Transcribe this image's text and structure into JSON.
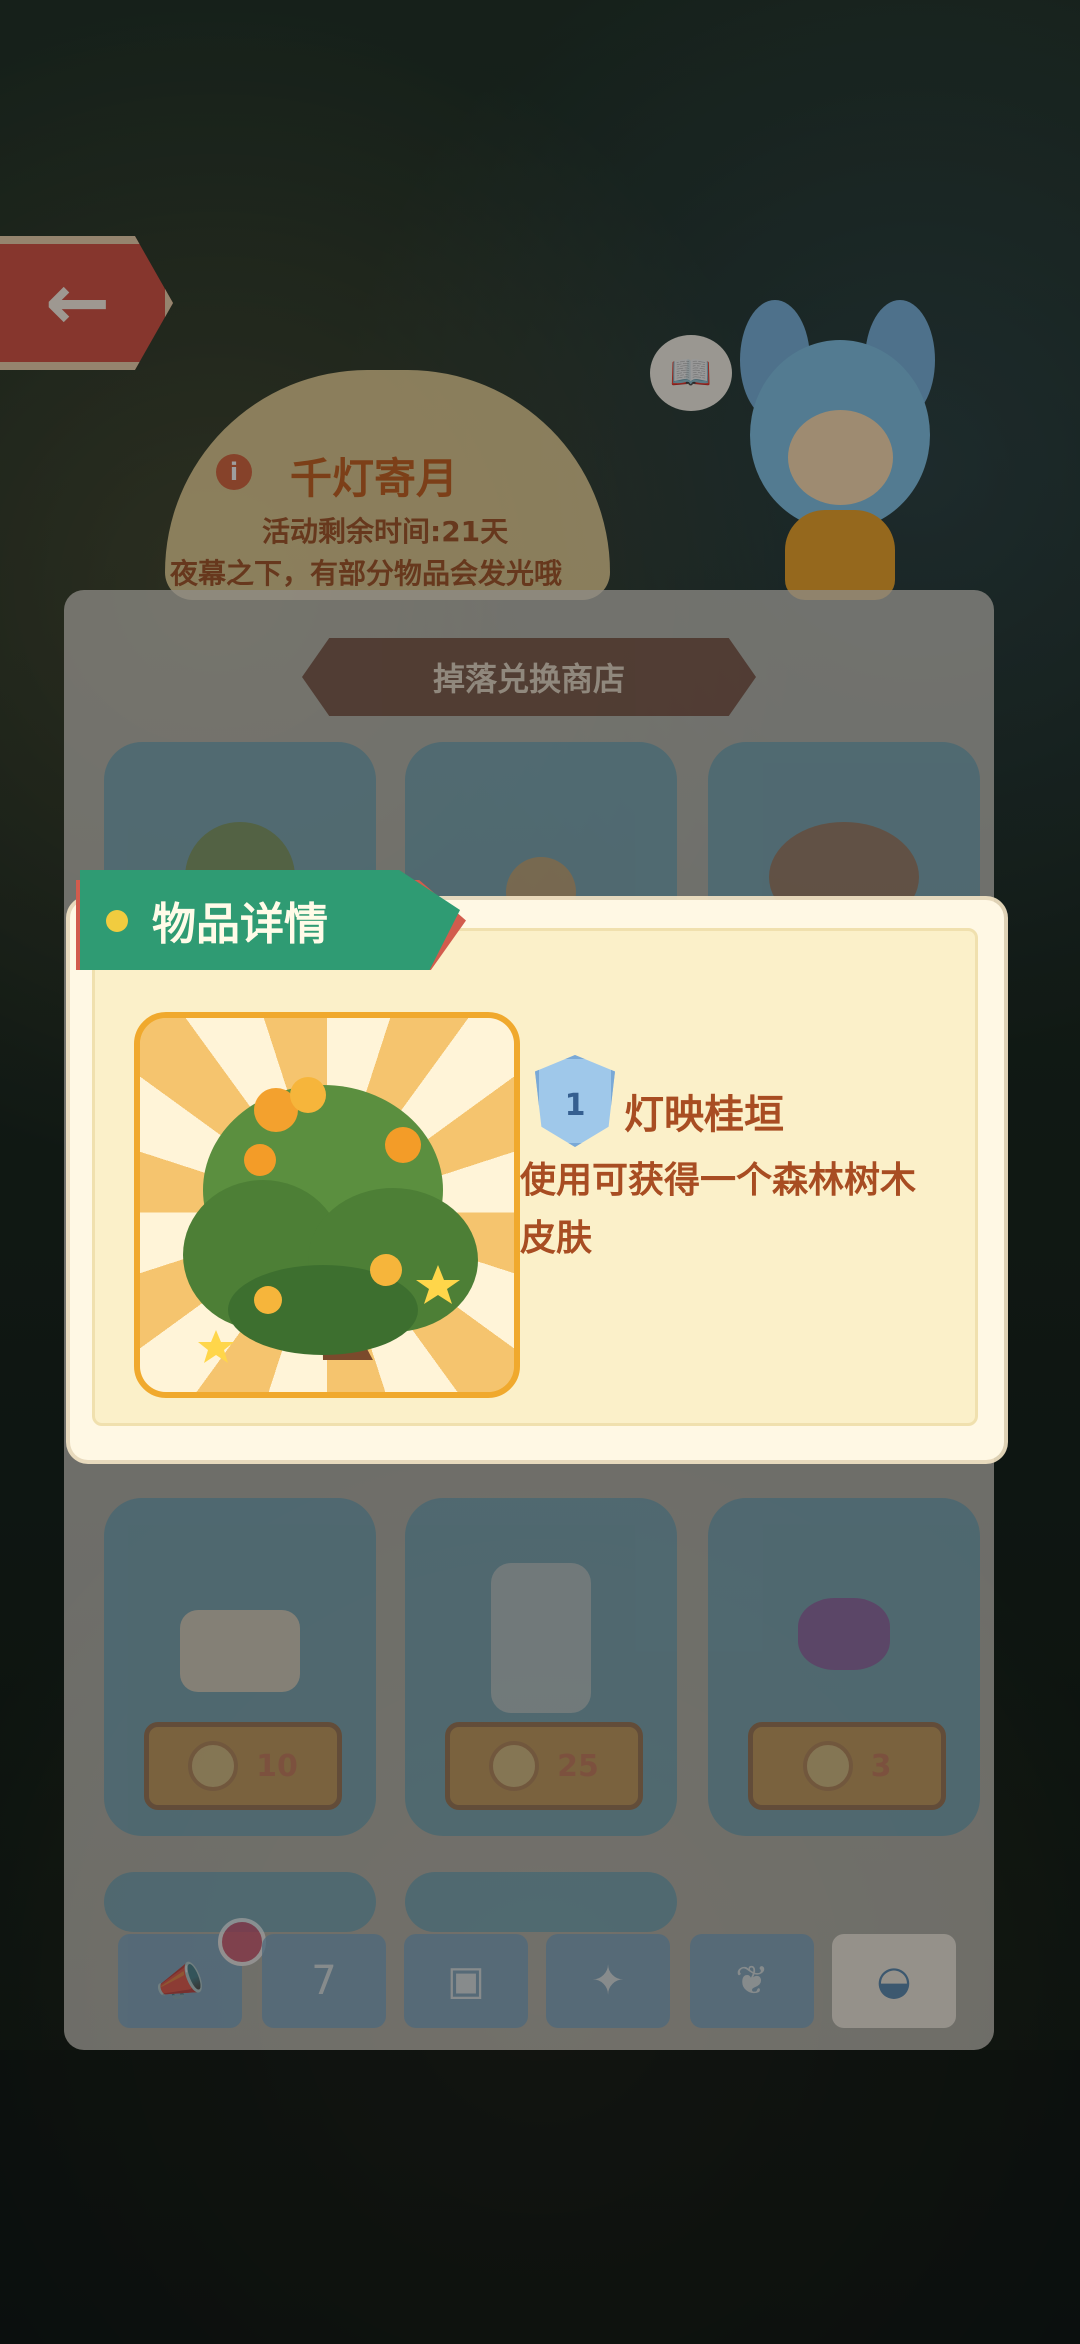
{
  "event": {
    "title": "千灯寄月",
    "time_left": "活动剩余时间:21天",
    "note": "夜幕之下，有部分物品会发光哦"
  },
  "shop": {
    "title": "掉落兑换商店",
    "items": [
      {
        "price": "10"
      },
      {
        "price": "25"
      },
      {
        "price": "3"
      }
    ]
  },
  "popup": {
    "header": "物品详情",
    "level": "1",
    "item_name": "灯映桂垣",
    "description": "使用可获得一个森林树木皮肤"
  },
  "tabs": [
    {
      "icon": "notification-icon"
    },
    {
      "icon": "calendar-icon"
    },
    {
      "icon": "album-icon"
    },
    {
      "icon": "gift-icon"
    },
    {
      "icon": "leaf-icon"
    },
    {
      "icon": "backpack-icon"
    }
  ],
  "colors": {
    "header_green": "#2f9b73",
    "accent_orange": "#f0a92d",
    "text_brown": "#a84d22",
    "back_red": "#d8574a"
  }
}
